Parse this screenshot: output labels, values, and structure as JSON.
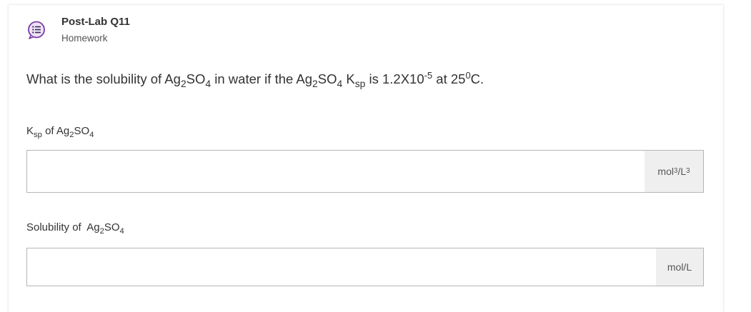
{
  "header": {
    "title": "Post-Lab Q11",
    "subtitle": "Homework",
    "icon": "question-list-icon",
    "icon_color": "#7a3aa8"
  },
  "question": {
    "p1": "What is the solubility of Ag",
    "s1": "2",
    "p2": "SO",
    "s2": "4",
    "p3": " in water if the Ag",
    "s3": "2",
    "p4": "SO",
    "s4": "4",
    "p5": " K",
    "s5": "sp",
    "p6": " is 1.2X10",
    "e1": "-5",
    "p7": " at 25",
    "e2": "0",
    "p8": "C."
  },
  "field1": {
    "label_k": "K",
    "label_sp": "sp",
    "label_of": " of Ag",
    "label_s2": "2",
    "label_so": "SO",
    "label_s4": "4",
    "value": "",
    "unit_mol": "mol",
    "unit_e1": "3",
    "unit_slash": "/L",
    "unit_e2": "3"
  },
  "field2": {
    "label_text": "Solubility of  Ag",
    "label_s2": "2",
    "label_so": "SO",
    "label_s4": "4",
    "value": "",
    "unit": "mol/L"
  }
}
